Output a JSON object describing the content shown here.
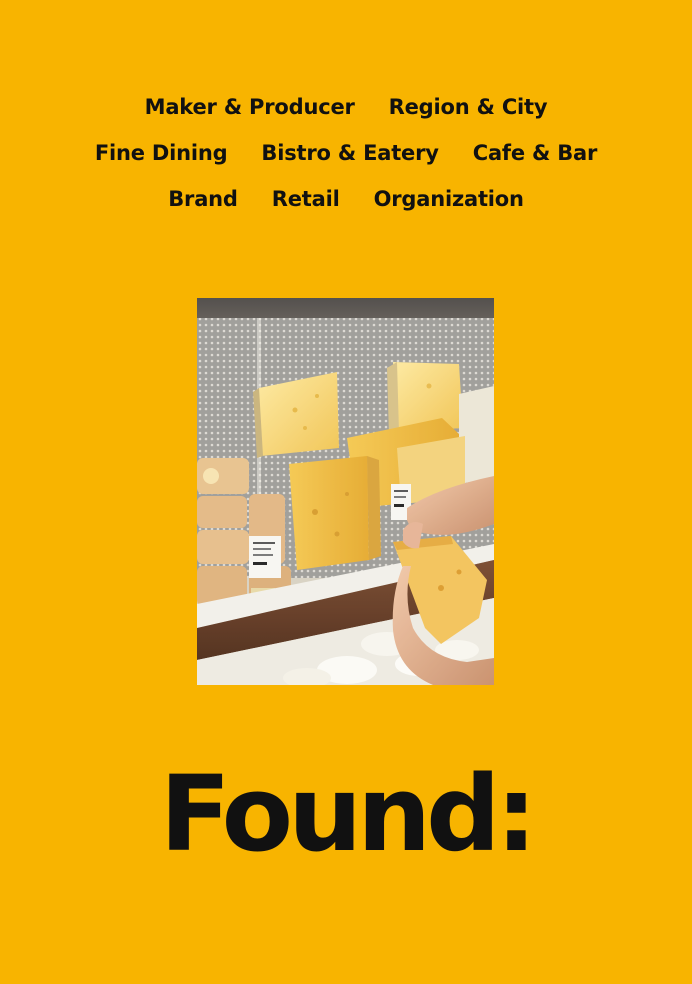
{
  "nav": {
    "rows": [
      [
        "Maker & Producer",
        "Region & City"
      ],
      [
        "Fine Dining",
        "Bistro & Eatery",
        "Cafe & Bar"
      ],
      [
        "Brand",
        "Retail",
        "Organization"
      ]
    ]
  },
  "hero": {
    "image_icon": "cheese-shop-photo"
  },
  "logo": {
    "text": "Found:"
  },
  "colors": {
    "background": "#f8b400",
    "text": "#111111"
  }
}
